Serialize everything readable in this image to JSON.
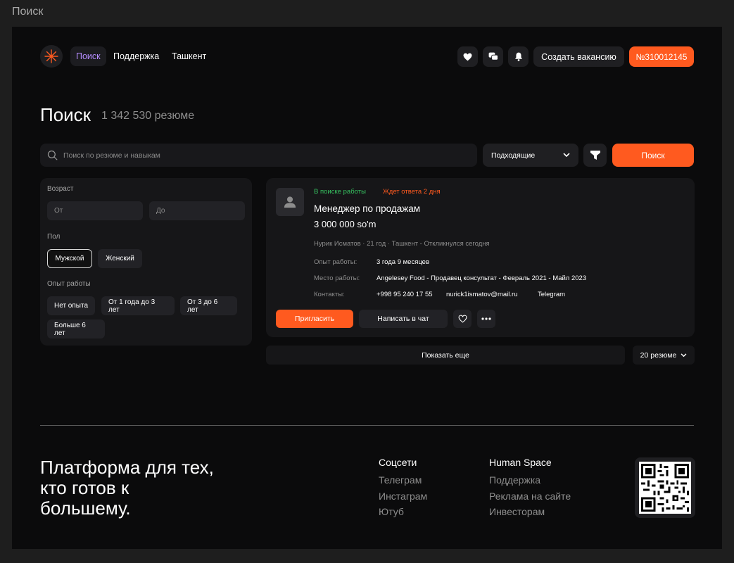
{
  "frame_title": "Поиск",
  "colors": {
    "accent": "#ff5a1f",
    "nav_active": "#b58cff",
    "status_green": "#37c160",
    "background": "#0b0b0c"
  },
  "header": {
    "nav": [
      "Поиск",
      "Поддержка",
      "Ташкент"
    ],
    "icons": [
      "heart-icon",
      "chat-icon",
      "bell-icon"
    ],
    "create_label": "Создать вакансию",
    "id_label": "№310012145"
  },
  "title": {
    "heading": "Поиск",
    "count": "1 342 530 резюме"
  },
  "search": {
    "placeholder": "Поиск по резюме и навыкам",
    "sort_value": "Подходящие",
    "button": "Поиск"
  },
  "filters": {
    "age_label": "Возраст",
    "age_from": "От",
    "age_to": "До",
    "gender_label": "Пол",
    "gender": [
      "Мужской",
      "Женский"
    ],
    "gender_selected": "Мужской",
    "experience_label": "Опыт работы",
    "experience": [
      "Нет опыта",
      "От 1 года до 3 лет",
      "От 3 до 6 лет",
      "Больше 6 лет"
    ]
  },
  "resume": {
    "status": "В поиске работы",
    "waiting": "Ждет ответа 2 дня",
    "title": "Менеджер по продажам",
    "salary": "3 000 000 so'm",
    "meta": "Нурик Исматов  ·  21 год  ·  Ташкент - Откликнулся сегодня",
    "experience_label": "Опыт работы:",
    "experience_value": "3 года 9 месяцев",
    "workplace_label": "Место работы:",
    "workplace_value": "Angelesey Food - Продавец консультат - Февраль 2021 - Майл 2023",
    "contacts_label": "Контакты:",
    "phone": "+998 95 240 17 55",
    "email": "nurick1ismatov@mail.ru",
    "telegram": "Telegram",
    "invite": "Пригласить",
    "chat": "Написать в чат"
  },
  "pagination": {
    "show_more": "Показать еще",
    "per_page": "20 резюме"
  },
  "footer": {
    "tagline": "Платформа для тех, кто готов к большему.",
    "social_head": "Соцсети",
    "social_links": [
      "Телеграм",
      "Инстаграм",
      "Ютуб"
    ],
    "company_head": "Human Space",
    "company_links": [
      "Поддержка",
      "Реклама на сайте",
      "Инвесторам"
    ]
  }
}
